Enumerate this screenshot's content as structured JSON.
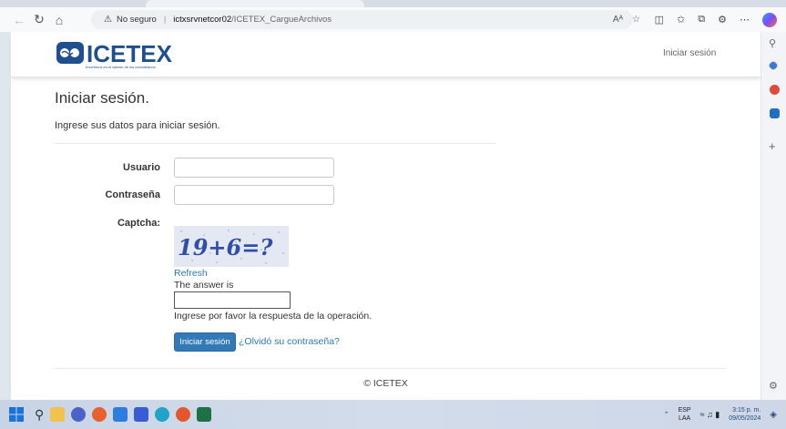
{
  "browser": {
    "security_label": "No seguro",
    "url_host": "ictxsrvnetcor02",
    "url_path": "/ICETEX_CargueArchivos",
    "read_aloud": "Aᴬ"
  },
  "header": {
    "logo_text": "ICETEX",
    "logo_tagline": "Invertimos en el talento de los colombianos",
    "login_link": "Iniciar sesión"
  },
  "main": {
    "title": "Iniciar sesión.",
    "subtitle": "Ingrese sus datos para iniciar sesión.",
    "form": {
      "username_label": "Usuario",
      "username_value": "",
      "password_label": "Contraseña",
      "password_value": "",
      "captcha_label": "Captcha:",
      "captcha_text": "19+6=?",
      "refresh_label": "Refresh",
      "answer_label": "The answer is",
      "answer_value": "",
      "hint": "Ingrese por favor la respuesta de la operación.",
      "submit_label": "Iniciar sesión",
      "forgot_label": "¿Olvidó su contraseña?"
    }
  },
  "footer": {
    "copyright": "© ICETEX"
  },
  "taskbar": {
    "lang_top": "ESP",
    "lang_bottom": "LAA",
    "time": "3:15 p. m.",
    "date": "09/05/2024"
  },
  "colors": {
    "primary_button": "#3279b7",
    "link": "#2a7ab8",
    "logo_blue": "#1f4f8e"
  }
}
